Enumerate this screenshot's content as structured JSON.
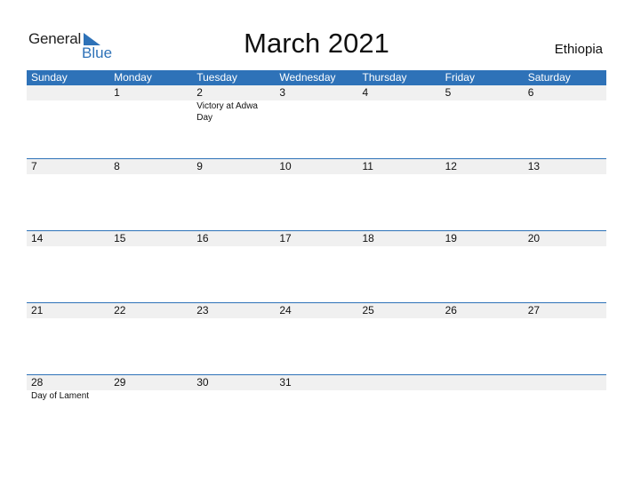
{
  "logo": {
    "general": "General",
    "blue": "Blue"
  },
  "title": "March 2021",
  "country": "Ethiopia",
  "colors": {
    "accent": "#2e72b8",
    "band": "#f0f0f0"
  },
  "weekdays": [
    "Sunday",
    "Monday",
    "Tuesday",
    "Wednesday",
    "Thursday",
    "Friday",
    "Saturday"
  ],
  "weeks": [
    [
      {
        "day": "",
        "event": ""
      },
      {
        "day": "1",
        "event": ""
      },
      {
        "day": "2",
        "event": "Victory at Adwa Day"
      },
      {
        "day": "3",
        "event": ""
      },
      {
        "day": "4",
        "event": ""
      },
      {
        "day": "5",
        "event": ""
      },
      {
        "day": "6",
        "event": ""
      }
    ],
    [
      {
        "day": "7",
        "event": ""
      },
      {
        "day": "8",
        "event": ""
      },
      {
        "day": "9",
        "event": ""
      },
      {
        "day": "10",
        "event": ""
      },
      {
        "day": "11",
        "event": ""
      },
      {
        "day": "12",
        "event": ""
      },
      {
        "day": "13",
        "event": ""
      }
    ],
    [
      {
        "day": "14",
        "event": ""
      },
      {
        "day": "15",
        "event": ""
      },
      {
        "day": "16",
        "event": ""
      },
      {
        "day": "17",
        "event": ""
      },
      {
        "day": "18",
        "event": ""
      },
      {
        "day": "19",
        "event": ""
      },
      {
        "day": "20",
        "event": ""
      }
    ],
    [
      {
        "day": "21",
        "event": ""
      },
      {
        "day": "22",
        "event": ""
      },
      {
        "day": "23",
        "event": ""
      },
      {
        "day": "24",
        "event": ""
      },
      {
        "day": "25",
        "event": ""
      },
      {
        "day": "26",
        "event": ""
      },
      {
        "day": "27",
        "event": ""
      }
    ],
    [
      {
        "day": "28",
        "event": "Day of Lament"
      },
      {
        "day": "29",
        "event": ""
      },
      {
        "day": "30",
        "event": ""
      },
      {
        "day": "31",
        "event": ""
      },
      {
        "day": "",
        "event": ""
      },
      {
        "day": "",
        "event": ""
      },
      {
        "day": "",
        "event": ""
      }
    ]
  ]
}
